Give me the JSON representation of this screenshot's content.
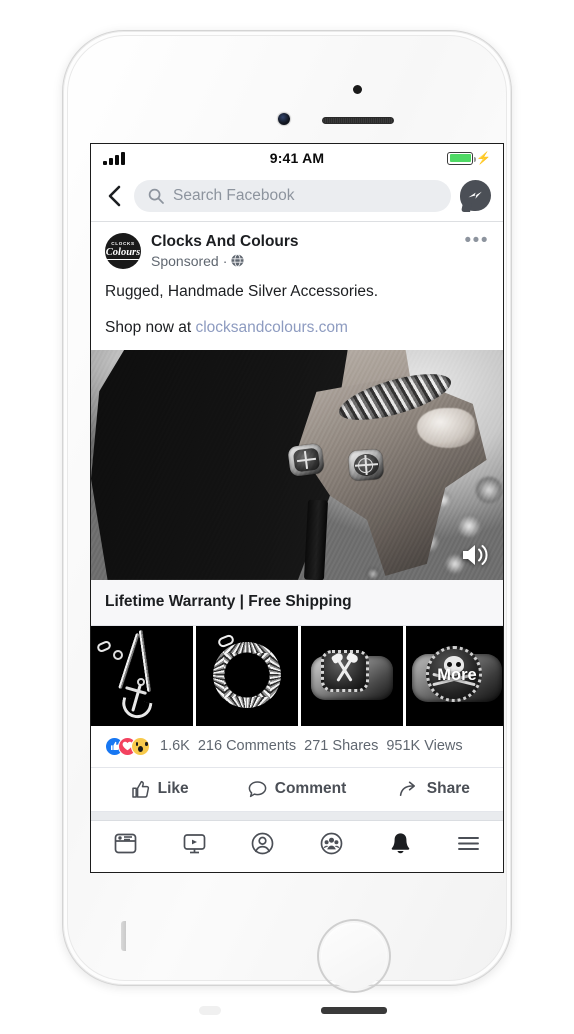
{
  "device": {
    "model_hint": "white-smartphone",
    "components": {
      "front_camera": "camera-icon",
      "earpiece": "speaker-grille",
      "home_button": "home-button"
    }
  },
  "status_bar": {
    "signal_icon": "signal-bars-icon",
    "signal_strength": 4,
    "time": "9:41 AM",
    "battery_icon": "battery-icon",
    "battery_level_percent": 100,
    "battery_color": "#4ed964",
    "charging_icon": "charging-bolt-icon"
  },
  "nav_header": {
    "back_icon": "back-chevron-icon",
    "search": {
      "icon": "search-icon",
      "placeholder": "Search Facebook",
      "value": ""
    },
    "messenger_icon": "messenger-icon"
  },
  "post": {
    "avatar": {
      "icon": "page-avatar",
      "logo_line1": "CLOCKS",
      "logo_line2": "Colours"
    },
    "page_name": "Clocks And Colours",
    "sponsored_label": "Sponsored",
    "meta_separator": "·",
    "privacy_icon": "globe-icon",
    "menu_icon": "ellipsis-icon",
    "body_text": "Rugged, Handmade Silver Accessories.",
    "cta_prefix": "Shop now at ",
    "cta_link_text": "clocksandcolours.com",
    "cta_link_color": "#8d9bc0"
  },
  "media": {
    "type": "video",
    "description": "black-and-white photo of a hand wearing two silver rings and a chain bracelet",
    "volume_icon": "volume-on-icon"
  },
  "caption": {
    "text": "Lifetime Warranty | Free Shipping"
  },
  "carousel": {
    "items": [
      {
        "name": "anchor-necklace-thumbnail",
        "label": ""
      },
      {
        "name": "curb-chain-bracelet-thumbnail",
        "label": ""
      },
      {
        "name": "axe-signet-ring-thumbnail",
        "label": ""
      },
      {
        "name": "skull-ring-thumbnail",
        "label": "More"
      }
    ]
  },
  "engagement": {
    "reactions": [
      {
        "name": "like-reaction",
        "glyph": "👍",
        "color": "#1877f2"
      },
      {
        "name": "love-reaction",
        "glyph": "❤",
        "color": "#f3425f"
      },
      {
        "name": "wow-reaction",
        "glyph": "😮",
        "color": "#f7c94b"
      }
    ],
    "reaction_count": "1.6K",
    "comments": "216 Comments",
    "shares": "271 Shares",
    "views": "951K Views"
  },
  "actions": [
    {
      "name": "like-button",
      "label": "Like",
      "icon": "thumbs-up-icon"
    },
    {
      "name": "comment-button",
      "label": "Comment",
      "icon": "comment-bubble-icon"
    },
    {
      "name": "share-button",
      "label": "Share",
      "icon": "share-arrow-icon"
    }
  ],
  "bottom_nav": [
    {
      "name": "news-feed-tab",
      "icon": "news-feed-icon",
      "active": false
    },
    {
      "name": "watch-tab",
      "icon": "video-screen-icon",
      "active": false
    },
    {
      "name": "profile-tab",
      "icon": "profile-circle-icon",
      "active": false
    },
    {
      "name": "groups-tab",
      "icon": "groups-icon",
      "active": false
    },
    {
      "name": "notifications-tab",
      "icon": "bell-icon",
      "active": true
    },
    {
      "name": "menu-tab",
      "icon": "hamburger-menu-icon",
      "active": false
    }
  ],
  "colors": {
    "facebook_blue": "#1877f2",
    "text_primary": "#1c1e21",
    "text_secondary": "#606770",
    "divider": "#e4e6eb",
    "search_field": "#ebedf0",
    "caption_bg": "#f7f7f9"
  }
}
